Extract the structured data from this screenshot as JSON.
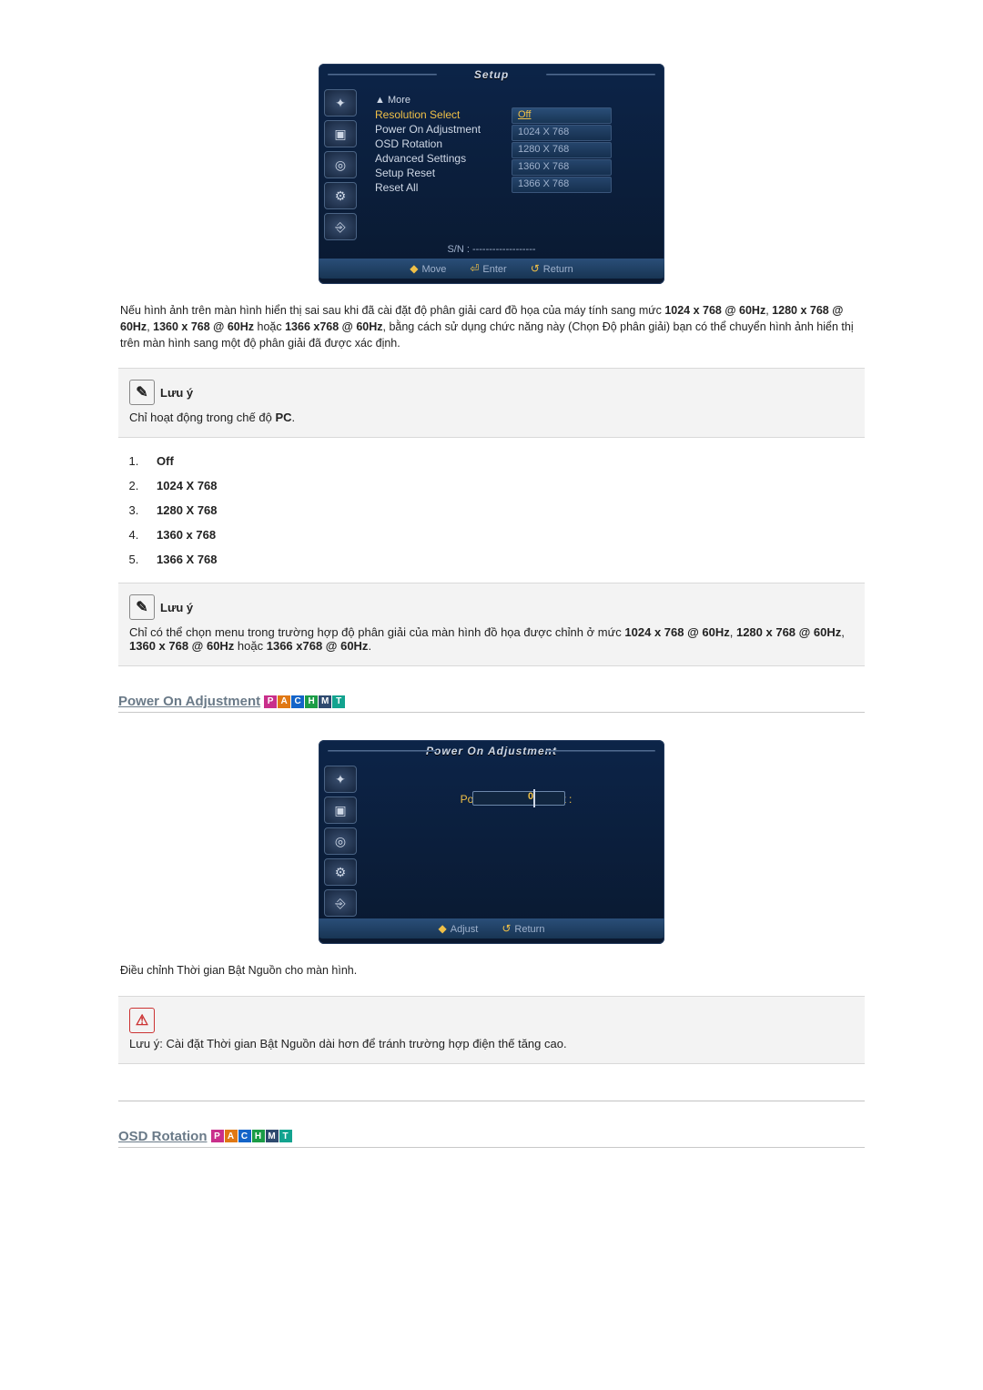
{
  "osd_setup": {
    "title": "Setup",
    "sidebar_icons": [
      "palette-icon",
      "image-icon",
      "target-icon",
      "gear-icon",
      "input-icon"
    ],
    "more_label": "▲ More",
    "menu_items": [
      {
        "label": "Resolution Select",
        "selected": true
      },
      {
        "label": "Power On Adjustment",
        "selected": false
      },
      {
        "label": "OSD Rotation",
        "selected": false
      },
      {
        "label": "Advanced Settings",
        "selected": false
      },
      {
        "label": "Setup Reset",
        "selected": false
      },
      {
        "label": "Reset All",
        "selected": false
      }
    ],
    "value_items": [
      {
        "label": "Off",
        "selected": true
      },
      {
        "label": "1024 X 768",
        "selected": false
      },
      {
        "label": "1280 X 768",
        "selected": false
      },
      {
        "label": "1360 X 768",
        "selected": false
      },
      {
        "label": "1366 X 768",
        "selected": false
      }
    ],
    "sn_label": "S/N : -------------------",
    "footer": {
      "move": "Move",
      "enter": "Enter",
      "return": "Return"
    }
  },
  "intro_text": {
    "pre": "Nếu hình ảnh trên màn hình hiển thị sai sau khi đã cài đặt độ phân giải card đồ họa của máy tính sang mức ",
    "r1": "1024 x 768 @ 60Hz",
    "c1": ", ",
    "r2": "1280 x 768 @ 60Hz",
    "c2": ", ",
    "r3": "1360 x 768 @ 60Hz",
    "c3": " hoặc ",
    "r4": "1366 x768 @ 60Hz",
    "tail": ", bằng cách sử dụng chức năng này (Chọn Độ phân giải) bạn có thể chuyển hình ảnh hiển thị trên màn hình sang một độ phân giải đã được xác định."
  },
  "note1": {
    "title": "Lưu ý",
    "pre": "Chỉ hoạt động trong chế độ ",
    "mode": "PC",
    "post": "."
  },
  "resolution_options": [
    "Off",
    "1024 X 768",
    "1280 X 768",
    "1360 x 768",
    "1366 X 768"
  ],
  "note2": {
    "title": "Lưu ý",
    "pre": "Chỉ có thể chọn menu trong trường hợp độ phân giải của màn hình đồ họa được chỉnh ở mức ",
    "r1": "1024 x 768 @ 60Hz",
    "c1": ", ",
    "r2": "1280 x 768 @ 60Hz",
    "c2": ", ",
    "r3": "1360 x 768 @ 60Hz",
    "c3": " hoặc ",
    "r4": "1366 x768 @ 60Hz",
    "post": "."
  },
  "section_power": {
    "title": "Power On Adjustment",
    "osd_title": "Power On Adjustment",
    "label": "Power On Adjustment :",
    "value": "0",
    "footer": {
      "adjust": "Adjust",
      "return": "Return"
    },
    "desc": "Điều chỉnh Thời gian Bật Nguồn cho màn hình.",
    "warn": "Lưu ý: Cài đặt Thời gian Bật Nguồn dài hơn để tránh trường hợp điện thế tăng cao."
  },
  "section_osdrot": {
    "title": "OSD Rotation"
  },
  "badges": [
    "P",
    "A",
    "C",
    "H",
    "M",
    "T"
  ]
}
